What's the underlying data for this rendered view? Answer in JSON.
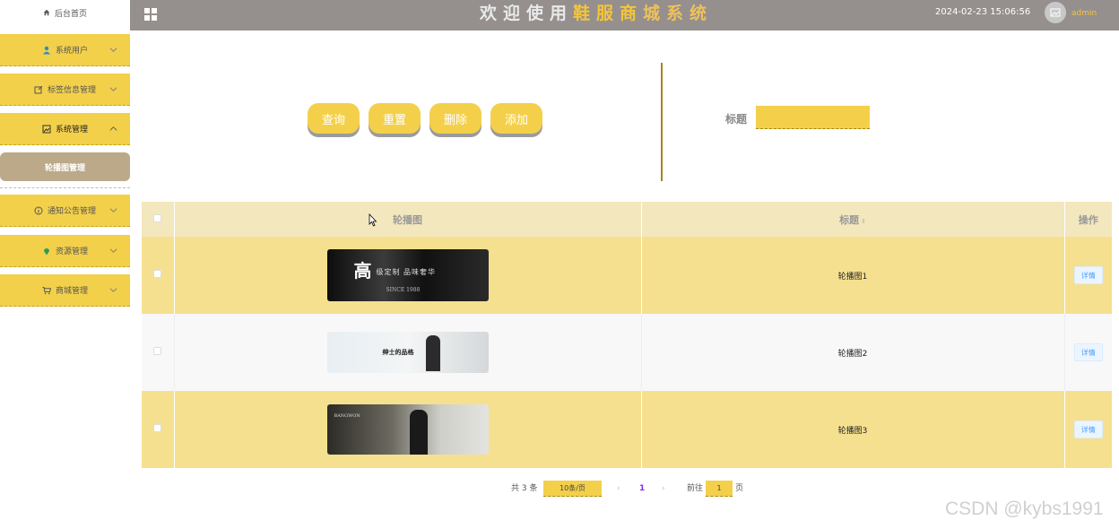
{
  "sidebar": {
    "home": "后台首页",
    "items": [
      {
        "label": "系统用户"
      },
      {
        "label": "标签信息管理"
      },
      {
        "label": "系统管理"
      },
      {
        "label": "通知公告管理"
      },
      {
        "label": "资源管理"
      },
      {
        "label": "商城管理"
      }
    ],
    "sub_item": "轮播图管理"
  },
  "header": {
    "title_part1": "欢迎使用",
    "title_part2": "鞋服商",
    "title_part3": "城系统",
    "datetime": "2024-02-23 15:06:56",
    "username": "admin"
  },
  "toolbar": {
    "query": "查询",
    "reset": "重置",
    "delete": "删除",
    "add": "添加",
    "search_label": "标题",
    "search_value": ""
  },
  "table": {
    "columns": [
      "轮播图",
      "标题",
      "操作"
    ],
    "rows": [
      {
        "title": "轮播图1",
        "action": "详情",
        "banner": {
          "big": "高",
          "line1": "级定制  品味奢华",
          "line2": "SINCE 1988"
        }
      },
      {
        "title": "轮播图2",
        "action": "详情",
        "banner": {
          "line1": "绅士的品格"
        }
      },
      {
        "title": "轮播图3",
        "action": "详情",
        "banner": {
          "line1": "BANGWON"
        }
      }
    ]
  },
  "pagination": {
    "total": "共 3 条",
    "page_size": "10条/页",
    "prev": "‹",
    "current": "1",
    "next": "›",
    "goto_label": "前往",
    "goto_value": "1",
    "page_suffix": "页"
  },
  "watermark": "CSDN @kybs1991",
  "colors": {
    "accent": "#f4d04a",
    "header": "#958f8e",
    "row_yellow": "#f5e08f",
    "sub_active": "#bca98a"
  }
}
